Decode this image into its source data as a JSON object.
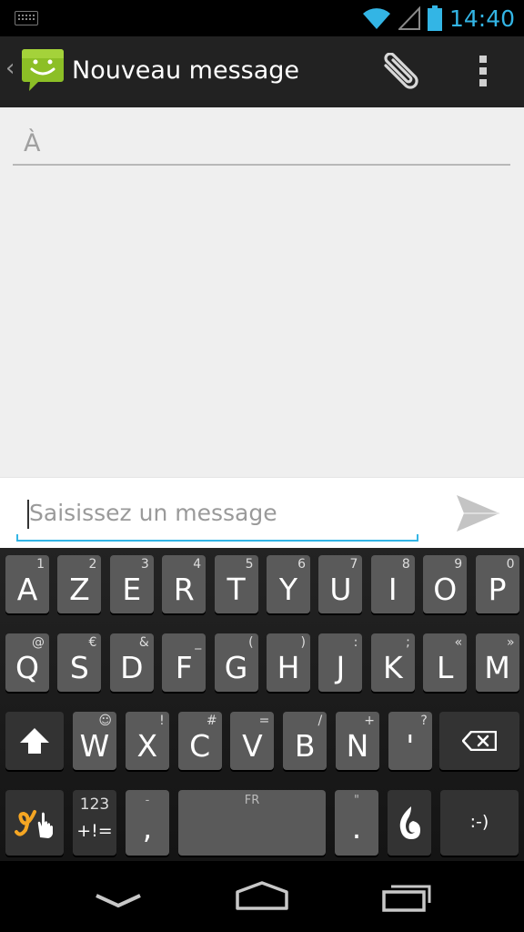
{
  "status_bar": {
    "time": "14:40",
    "icons": [
      "keyboard-icon",
      "wifi-icon",
      "signal-icon",
      "battery-icon"
    ],
    "accent": "#33b5e5"
  },
  "action_bar": {
    "title": "Nouveau message",
    "icons": [
      "messaging-app-icon",
      "attach-icon",
      "overflow-menu-icon"
    ]
  },
  "recipient": {
    "placeholder": "À"
  },
  "compose": {
    "placeholder": "Saisissez un message",
    "send_icon": "send-icon"
  },
  "keyboard": {
    "row1": [
      {
        "label": "A",
        "hint": "1"
      },
      {
        "label": "Z",
        "hint": "2"
      },
      {
        "label": "E",
        "hint": "3"
      },
      {
        "label": "R",
        "hint": "4"
      },
      {
        "label": "T",
        "hint": "5"
      },
      {
        "label": "Y",
        "hint": "6"
      },
      {
        "label": "U",
        "hint": "7"
      },
      {
        "label": "I",
        "hint": "8"
      },
      {
        "label": "O",
        "hint": "9"
      },
      {
        "label": "P",
        "hint": "0"
      }
    ],
    "row2": [
      {
        "label": "Q",
        "hint": "@"
      },
      {
        "label": "S",
        "hint": "€"
      },
      {
        "label": "D",
        "hint": "&"
      },
      {
        "label": "F",
        "hint": "_"
      },
      {
        "label": "G",
        "hint": "("
      },
      {
        "label": "H",
        "hint": ")"
      },
      {
        "label": "J",
        "hint": ":"
      },
      {
        "label": "K",
        "hint": ";"
      },
      {
        "label": "L",
        "hint": "«"
      },
      {
        "label": "M",
        "hint": "»"
      }
    ],
    "row3": [
      {
        "label": "W",
        "hint": "☺"
      },
      {
        "label": "X",
        "hint": "!"
      },
      {
        "label": "C",
        "hint": "#"
      },
      {
        "label": "V",
        "hint": "="
      },
      {
        "label": "B",
        "hint": "/"
      },
      {
        "label": "N",
        "hint": "+"
      },
      {
        "label": "'",
        "hint": "?"
      }
    ],
    "symbols_top": "123",
    "symbols_bottom": "+!=",
    "comma_hint": "-",
    "comma": ",",
    "space_hint": "FR",
    "period_hint": "\"",
    "period": ".",
    "emoticon": ":-)"
  },
  "nav_bar": {
    "icons": [
      "back-icon",
      "home-icon",
      "recents-icon"
    ]
  }
}
